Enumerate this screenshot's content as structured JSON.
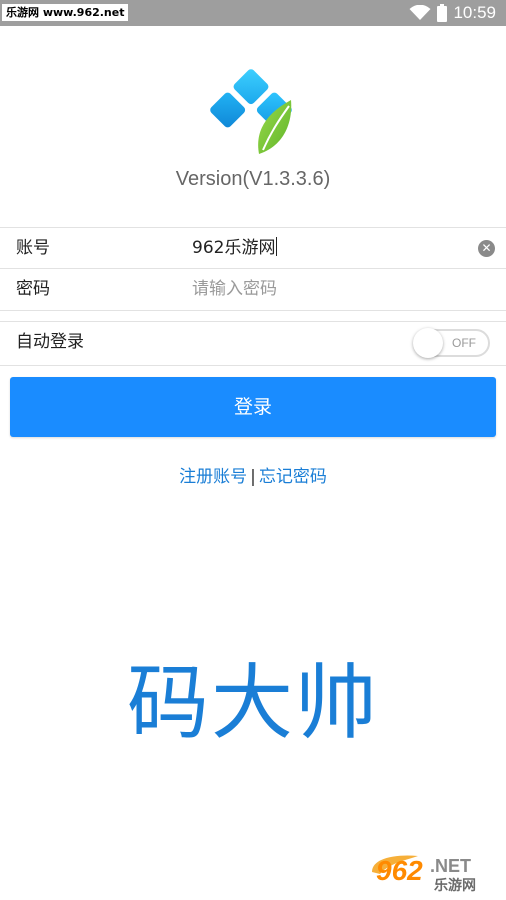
{
  "status_bar": {
    "watermark": "乐游网 www.962.net",
    "time": "10:59"
  },
  "app": {
    "version": "Version(V1.3.3.6)",
    "brand": "码大帅"
  },
  "form": {
    "account_label": "账号",
    "account_value": "962乐游网",
    "password_label": "密码",
    "password_placeholder": "请输入密码",
    "auto_login_label": "自动登录",
    "auto_login_state": "OFF"
  },
  "actions": {
    "login_label": "登录",
    "register_label": "注册账号",
    "separator": "|",
    "forgot_label": "忘记密码"
  },
  "watermark_bottom": {
    "text_962": "962",
    "text_net": ".NET",
    "text_cn": "乐游网"
  },
  "colors": {
    "accent": "#1a8cff",
    "link": "#1a7ed6",
    "status_bar": "#9e9e9e"
  }
}
